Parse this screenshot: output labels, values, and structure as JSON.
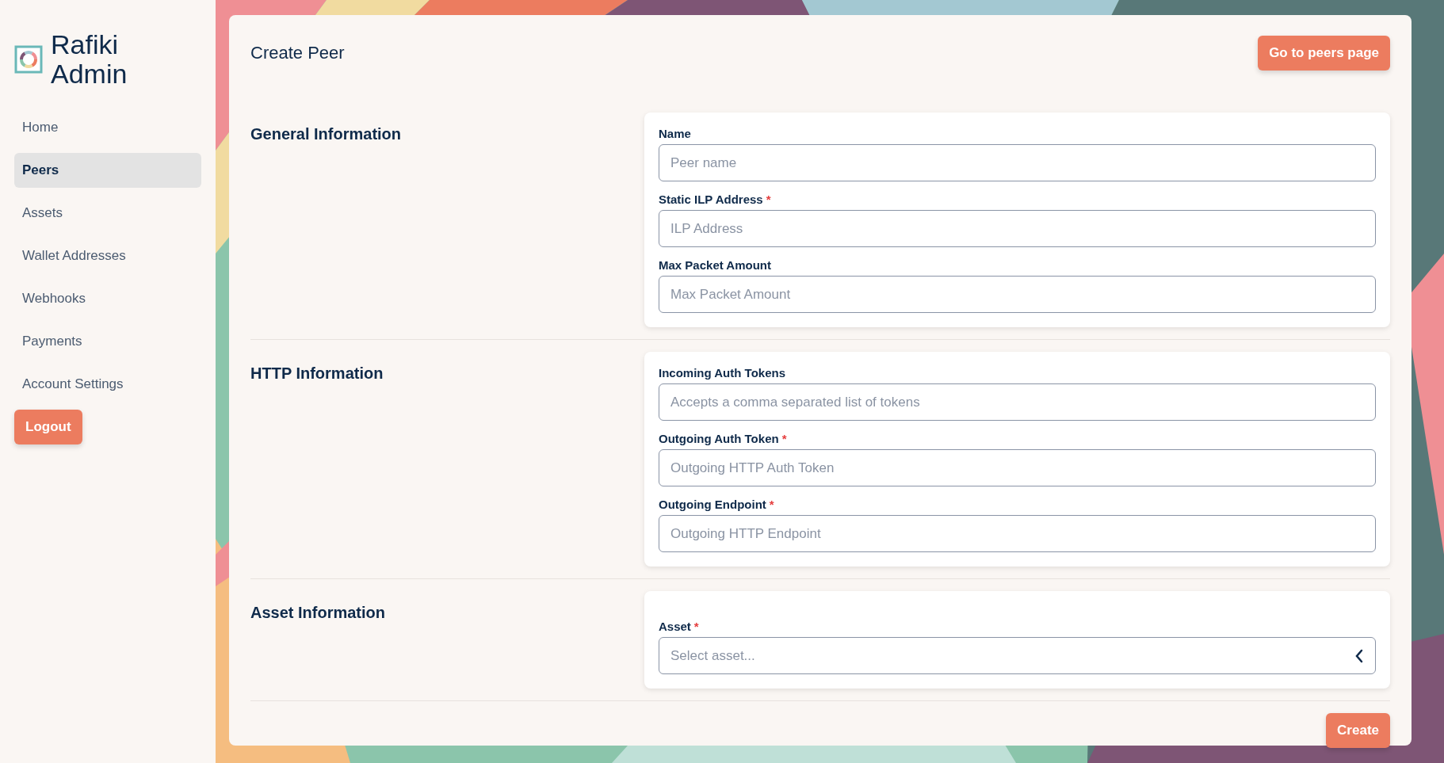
{
  "sidebar": {
    "title": "Rafiki Admin",
    "nav": [
      {
        "label": "Home",
        "selected": false
      },
      {
        "label": "Peers",
        "selected": true
      },
      {
        "label": "Assets",
        "selected": false
      },
      {
        "label": "Wallet Addresses",
        "selected": false
      },
      {
        "label": "Webhooks",
        "selected": false
      },
      {
        "label": "Payments",
        "selected": false
      },
      {
        "label": "Account Settings",
        "selected": false
      }
    ],
    "logout": "Logout"
  },
  "page": {
    "title": "Create Peer",
    "action": "Go to peers page"
  },
  "sections": [
    {
      "title": "General Information",
      "fields": [
        {
          "kind": "text",
          "label": "Name",
          "placeholder": "Peer name"
        },
        {
          "kind": "text",
          "label": "Static ILP Address",
          "required_mark": "*",
          "placeholder": "ILP Address"
        },
        {
          "kind": "text",
          "label": "Max Packet Amount",
          "placeholder": "Max Packet Amount"
        }
      ]
    },
    {
      "title": "HTTP Information",
      "fields": [
        {
          "kind": "text",
          "label": "Incoming Auth Tokens",
          "placeholder": "Accepts a comma separated list of tokens"
        },
        {
          "kind": "text",
          "label": "Outgoing Auth Token",
          "required_mark": "*",
          "placeholder": "Outgoing HTTP Auth Token"
        },
        {
          "kind": "text",
          "label": "Outgoing Endpoint",
          "required_mark": "*",
          "placeholder": "Outgoing HTTP Endpoint"
        }
      ]
    },
    {
      "title": "Asset Information",
      "fields": [
        {
          "kind": "select",
          "label": "Asset",
          "required_mark": "*",
          "placeholder": "Select asset..."
        }
      ]
    }
  ],
  "submit": "Create"
}
